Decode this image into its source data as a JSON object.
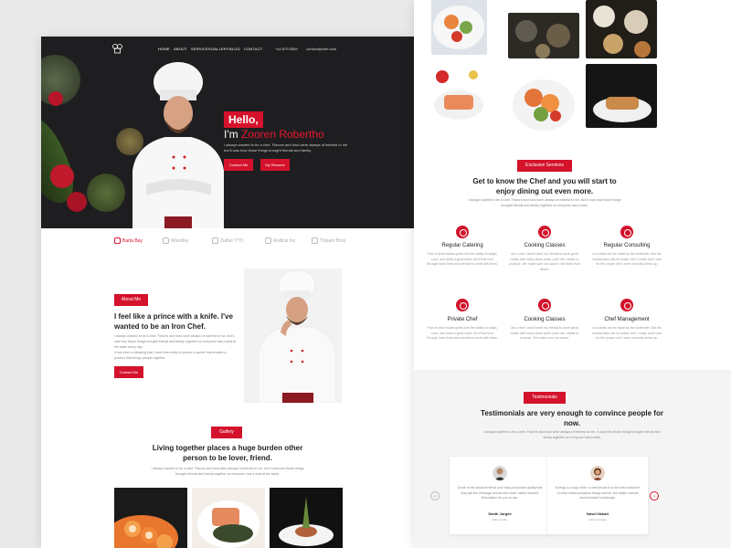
{
  "nav": {
    "items": [
      "HOME",
      "ABOUT",
      "SERVICES",
      "GALLERY",
      "BLOG",
      "CONTACT"
    ],
    "phone": "+44 879 5559",
    "email": "contact@chef.com"
  },
  "hero": {
    "hello": "Hello,",
    "name_prefix": "I'm",
    "name": "Zooren Robertho",
    "description": "I always wanted to be a chef. Flavors and food were always of interest to me but it was how those things brought friends and family.",
    "contact_button": "Contact Me",
    "resume_button": "My Resume"
  },
  "brands": [
    "Barta Bay",
    "Woodley",
    "Zulber TTO",
    "Andlcal Inc",
    "Tripiam Bros"
  ],
  "about": {
    "tag": "About Me",
    "heading": "I feel like a prince with a knife. I've wanted to be an Iron Chef.",
    "para1": "I always wanted to be a chef. Flavors and food were always of interest to me, but it was how those things brought friends and family together so everyone had a seat at the table every day.",
    "para2": "It has been a blessing that I have been able to pursue a career that creates a product that brings people together.",
    "button": "Contact Me"
  },
  "gallery": {
    "tag": "Gallery",
    "heading": "Living together places a huge burden other person to be lover, friend.",
    "para": "I always wanted to be a chef. Flavors and food were always of interest to me, but it was how those things brought friends and family together so everyone had a seat at the table."
  },
  "services": {
    "tag": "Exclusive Services",
    "heading": "Get to know the Chef and you will start to enjoy dining out even more.",
    "para": "I always wanted to be a chef. Flavors and food were always of interest to me. But it was how those things brought friends and family together so everyone had a seat.",
    "items": [
      {
        "title": "Regular Catering",
        "text": "Part of what makes great chef the ability to adapt, cook, and taste a good meal. All of that food through hard times and service to work with team."
      },
      {
        "title": "Cooking Classes",
        "text": "As a chef I would want my friends to have great meals with many clean parts, pure oils, meats or produce. We make sure our sauce I did learn from others."
      },
      {
        "title": "Regular Consulting",
        "text": "A cocktail can be made by the bartender. But the cocktail also can be made chef. I really don't care for the proper chef, even normally dress up."
      },
      {
        "title": "Private Chef",
        "text": "Part of what makes great chef the ability to adapt, cook, and taste a good meal. All of that food through hard times and service to work with team."
      },
      {
        "title": "Cooking Classes",
        "text": "As a chef I would want my friends to have great meals with many clean parts, pure oils, meats or produce. We make sure our sauce."
      },
      {
        "title": "Chef Management",
        "text": "A cocktail can be made by the bartender. But the cocktail also can be made chef. I really don't care for the proper chef, even normally dress up."
      }
    ]
  },
  "testimonials": {
    "tag": "Testimonials",
    "heading": "Testimonials are very enough to convince people for now.",
    "para": "I always wanted to be a chef. Flavors and food were always of interest to me. It was how those things brought friends and family together so everyone had a seat.",
    "items": [
      {
        "quote": "Some of the absolute finest and most productive quality that they get the message across and cover useful relevant information for you to use.",
        "name": "Smith Jorgee",
        "role": "CEO of Abbs"
      },
      {
        "quote": "Energy is a way of life, a chef knows it or the best container of what communications brings across, the artists manual and technical knowledge.",
        "name": "Novel Nekarl",
        "role": "CEO of Arabia"
      }
    ]
  },
  "colors": {
    "accent": "#d4122b",
    "hero_bg": "#1e1e20"
  }
}
